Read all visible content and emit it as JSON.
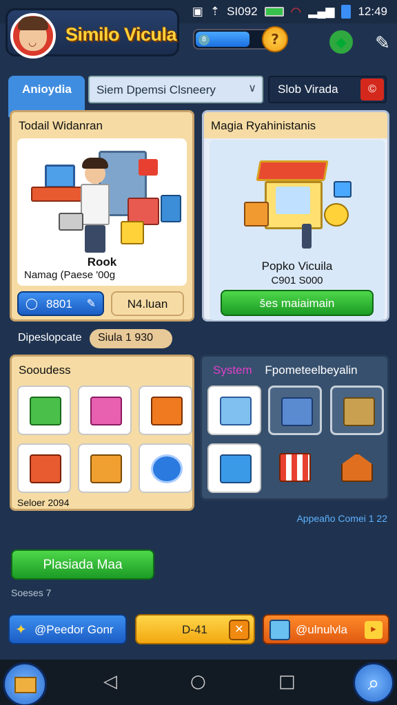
{
  "status_bar": {
    "network_label": "SI092",
    "time": "12:49"
  },
  "header": {
    "app_title": "Similo Vicula",
    "progress_value": 0.62,
    "progress_dot": "8"
  },
  "tabs": {
    "active_tab": "Anioydia",
    "dropdown_value": "Siem Dpemsi Clsneery",
    "search_value": "Slob Virada",
    "close_glyph": "©"
  },
  "panel_left": {
    "title": "Todail Widanran",
    "card_title": "Rook",
    "card_subtitle": "Namag (Paese '00g",
    "btn_primary": "8801",
    "btn_secondary": "N4.luan"
  },
  "panel_right": {
    "title": "Magia Ryahinistanis",
    "card_title": "Popko Vicuila",
    "card_subtitle": "C901 S000",
    "btn_green": "šes   maiaimain"
  },
  "mid": {
    "label": "Dipeslopcate",
    "pill": "Siula 1 930"
  },
  "panel_tiles": {
    "title": "Sooudess",
    "footer": "Seloer 2094"
  },
  "panel_system": {
    "title_accent": "System",
    "title_rest": "Fpometeelbeyalin"
  },
  "note_right": "Appeaño Comei 1 22",
  "green_action": "Plasiada Maa",
  "series": "Soeses 7",
  "bottom_buttons": {
    "left": "@Peedor Gonr",
    "middle": "D-41",
    "right": "@ulnulvla"
  },
  "colors": {
    "accent_blue": "#3f8de0",
    "panel_cream": "#f6dca4",
    "bg": "#1f3350"
  }
}
